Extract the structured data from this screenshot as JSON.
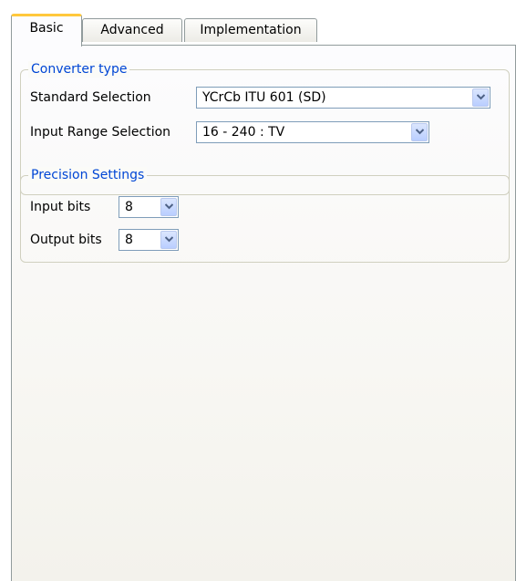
{
  "tabs": [
    {
      "label": "Basic",
      "active": true
    },
    {
      "label": "Advanced",
      "active": false
    },
    {
      "label": "Implementation",
      "active": false
    }
  ],
  "converter_type": {
    "title": "Converter type",
    "standard_selection": {
      "label": "Standard Selection",
      "value": "YCrCb ITU 601 (SD)"
    },
    "input_range_selection": {
      "label": "Input Range Selection",
      "value": "16 - 240 : TV"
    }
  },
  "precision_settings": {
    "title": "Precision Settings",
    "input_bits": {
      "label": "Input bits",
      "value": "8"
    },
    "output_bits": {
      "label": "Output bits",
      "value": "8"
    }
  },
  "colors": {
    "accent_tab": "#ffc83c",
    "group_title": "#0046d5",
    "border": "#919b9c"
  }
}
